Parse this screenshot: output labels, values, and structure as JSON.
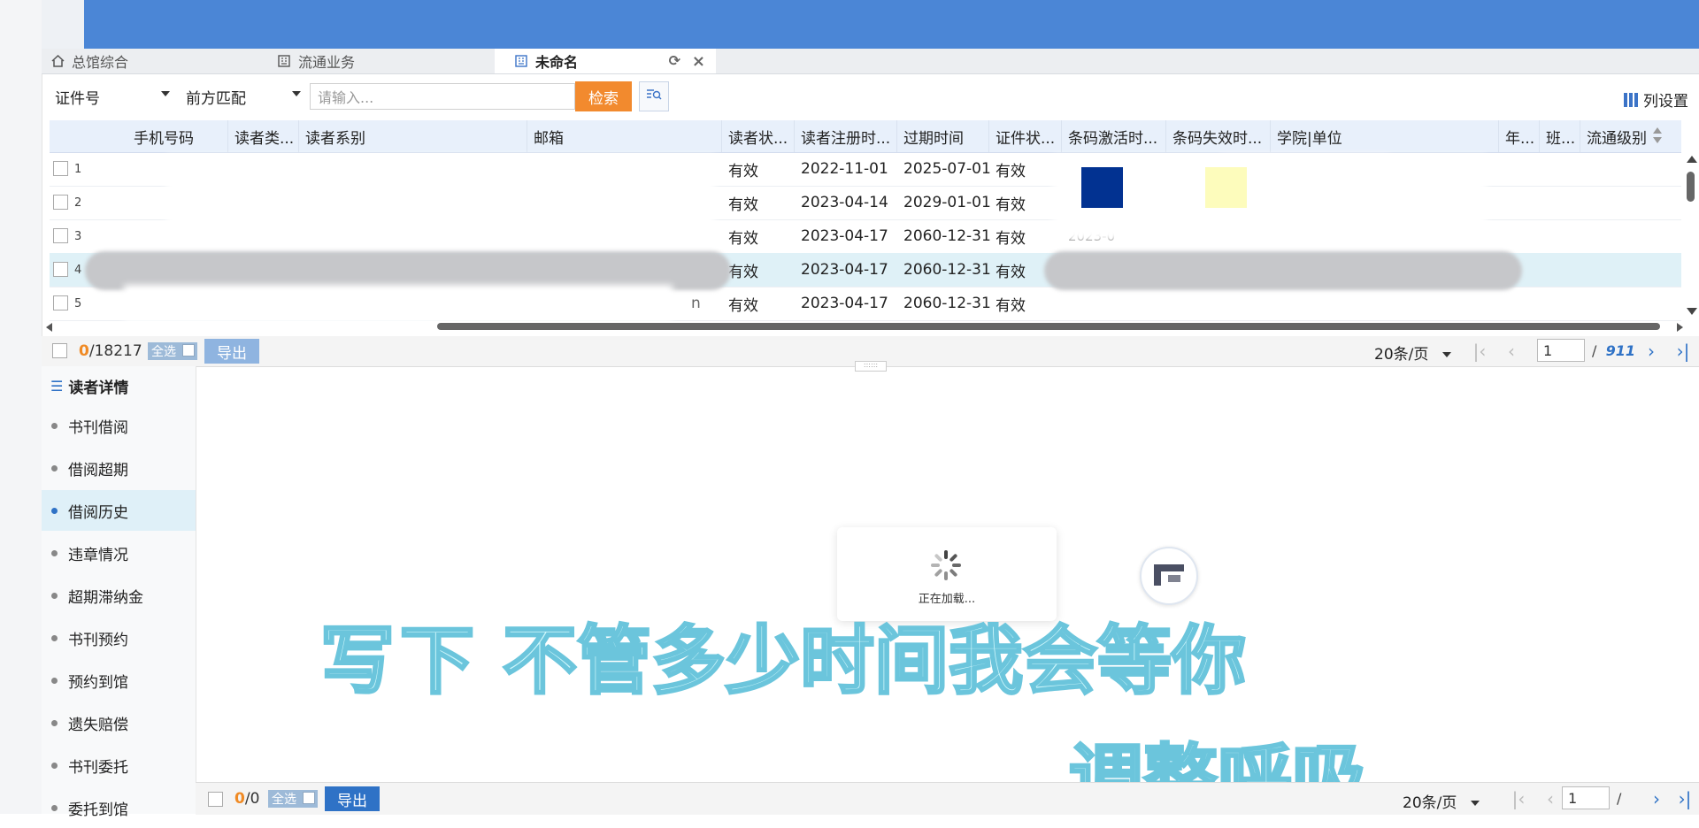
{
  "tabs": [
    {
      "label": "总馆综合"
    },
    {
      "label": "流通业务"
    },
    {
      "label": "未命名"
    }
  ],
  "search": {
    "field_select": "证件号",
    "match_select": "前方匹配",
    "placeholder": "请输入...",
    "search_button": "检索"
  },
  "column_settings_label": "列设置",
  "columns": [
    "手机号码",
    "读者类...",
    "读者系别",
    "邮箱",
    "读者状...",
    "读者注册时...",
    "过期时间",
    "证件状...",
    "条码激活时...",
    "条码失效时...",
    "学院|单位",
    "年...",
    "班...",
    "流通级别"
  ],
  "rows": [
    {
      "num": "1",
      "reader_status": "有效",
      "register_date": "2022-11-01",
      "expire_date": "2025-07-01",
      "card_status": "有效",
      "barcode_activate": ""
    },
    {
      "num": "2",
      "reader_status": "有效",
      "register_date": "2023-04-14",
      "expire_date": "2029-01-01",
      "card_status": "有效",
      "barcode_activate": ""
    },
    {
      "num": "3",
      "reader_status": "有效",
      "register_date": "2023-04-17",
      "expire_date": "2060-12-31",
      "card_status": "有效",
      "barcode_activate": "2023-0"
    },
    {
      "num": "4",
      "reader_status": "有效",
      "register_date": "2023-04-17",
      "expire_date": "2060-12-31",
      "card_status": "有效",
      "barcode_activate": ""
    },
    {
      "num": "5",
      "reader_status": "有效",
      "register_date": "2023-04-17",
      "expire_date": "2060-12-31",
      "card_status": "有效",
      "barcode_activate": ""
    }
  ],
  "row5_fragment": "n",
  "pager": {
    "selected": "0",
    "total": "/18217",
    "select_all": "全选",
    "export": "导出",
    "per_page": "20条/页",
    "page": "1",
    "page_sep": "/",
    "page_total": "911"
  },
  "sidebar": {
    "title": "读者详情",
    "items": [
      "书刊借阅",
      "借阅超期",
      "借阅历史",
      "违章情况",
      "超期滞纳金",
      "书刊预约",
      "预约到馆",
      "遗失赔偿",
      "书刊委托",
      "委托到馆"
    ]
  },
  "loading_text": "正在加载...",
  "overlay": {
    "line1_a": "写下",
    "line1_b": "不管多少时间我会等你",
    "line2": "调整呼吸"
  },
  "bottom_pager": {
    "selected": "0",
    "total": "/0",
    "select_all": "全选",
    "export": "导出",
    "per_page": "20条/页",
    "page": "1",
    "page_sep": "/"
  },
  "colors": {
    "banner": "#4b86d6",
    "accent": "#2f72c6",
    "search_button": "#f28a2e",
    "row_highlight": "#dff1f7",
    "header_bg": "#e8f0fb"
  }
}
